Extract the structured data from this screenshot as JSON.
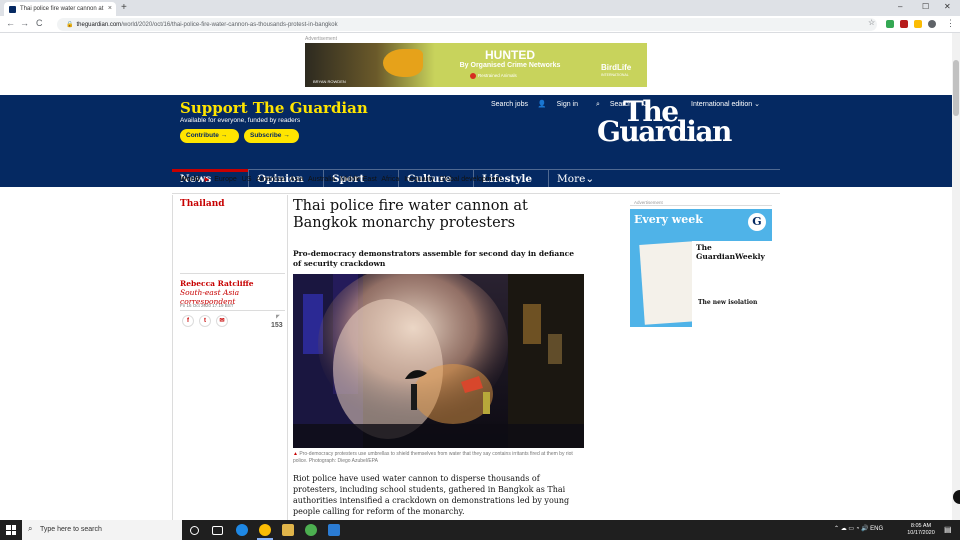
{
  "browser": {
    "tab_title": "Thai police fire water cannon at",
    "new_tab": "+",
    "url_host": "theguardian.com",
    "url_path": "/world/2020/oct/16/thai-police-fire-water-cannon-as-thousands-protest-in-bangkok",
    "win_min": "–",
    "win_max": "☐",
    "win_close": "✕",
    "back": "←",
    "forward": "→",
    "reload": "C"
  },
  "ad_top": {
    "label": "Advertisement",
    "headline": "HUNTED",
    "subline": "By Organised Crime Networks",
    "partner": "Restrained Animals",
    "photo_credit": "BRYAN ROWDEN",
    "logo": "BirdLife",
    "logo_sub": "INTERNATIONAL"
  },
  "header": {
    "support_title": "Support The Guardian",
    "support_sub": "Available for everyone, funded by readers",
    "contribute": "Contribute →",
    "subscribe": "Subscribe →",
    "search_jobs": "Search jobs",
    "sign_in": "Sign in",
    "search": "Search",
    "edition": "International edition",
    "logo_line1": "The",
    "logo_line2": "Guardian"
  },
  "pillars": [
    {
      "label": "News"
    },
    {
      "label": "Opinion"
    },
    {
      "label": "Sport"
    },
    {
      "label": "Culture"
    },
    {
      "label": "Lifestyle"
    },
    {
      "label": "More"
    }
  ],
  "subnav": {
    "world": "World",
    "arrow": "▶",
    "items": [
      "Europe",
      "US",
      "Americas",
      "Asia",
      "Australia",
      "Middle East",
      "Africa",
      "Inequality",
      "Global development"
    ]
  },
  "article": {
    "section": "Thailand",
    "author_name": "Rebecca Ratcliffe",
    "author_role": "South-east Asia correspondent",
    "date": "Fri 16 Oct 2020 17.19 BST",
    "comment_count": "153",
    "headline": "Thai police fire water cannon at Bangkok monarchy protesters",
    "standfirst": "Pro-democracy demonstrators assemble for second day in defiance of security crackdown",
    "caption": "Pro-democracy protesters use umbrellas to shield themselves from water that they say contains irritants fired at them by riot police. Photograph: Diego Azubel/EPA",
    "body_p1": "Riot police have used water cannon to disperse thousands of protesters, including school students, gathered in Bangkok as Thai authorities intensified a crackdown on demonstrations led by young people calling for reform of the monarchy."
  },
  "ad_right": {
    "label": "Advertisement",
    "title": "Every week",
    "mag_head": "The GuardianWeekly",
    "mag_story": "The new isolation",
    "logo": "G"
  },
  "taskbar": {
    "search_placeholder": "Type here to search",
    "lang": "ENG",
    "time": "8:05 AM",
    "date": "10/17/2020"
  },
  "colors": {
    "guardian_blue": "#052962",
    "guardian_yellow": "#ffe500",
    "guardian_red": "#c70000"
  }
}
